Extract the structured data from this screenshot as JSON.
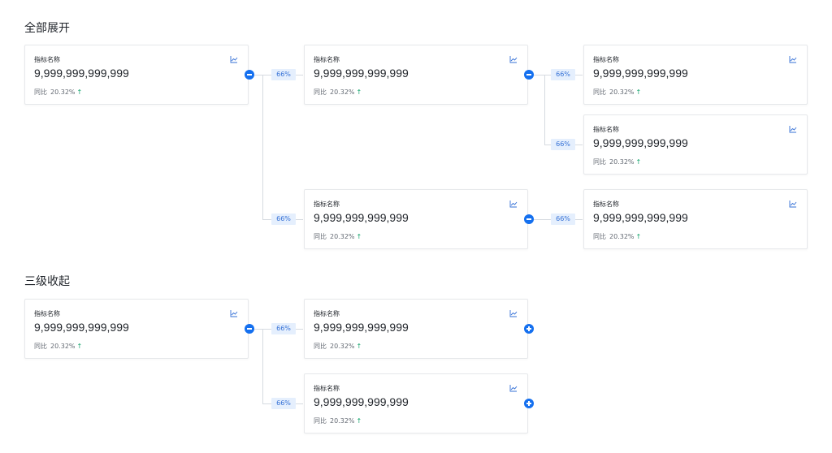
{
  "sections": {
    "expanded_title": "全部展开",
    "collapsed_title": "三级收起"
  },
  "card": {
    "name": "指标名称",
    "value": "9,999,999,999,999",
    "yoy_label": "同比",
    "yoy_value": "20.32%",
    "yoy_arrow": "↑"
  },
  "badge": {
    "ratio": "66%"
  },
  "icons": {
    "trend": "line-chart-icon",
    "collapse": "minus-circle-icon",
    "expand": "plus-circle-icon"
  },
  "colors": {
    "accent": "#1570ef",
    "badge_bg": "#e5effd",
    "badge_text": "#3470d6",
    "up": "#12a36b",
    "border": "#e6e8eb"
  }
}
